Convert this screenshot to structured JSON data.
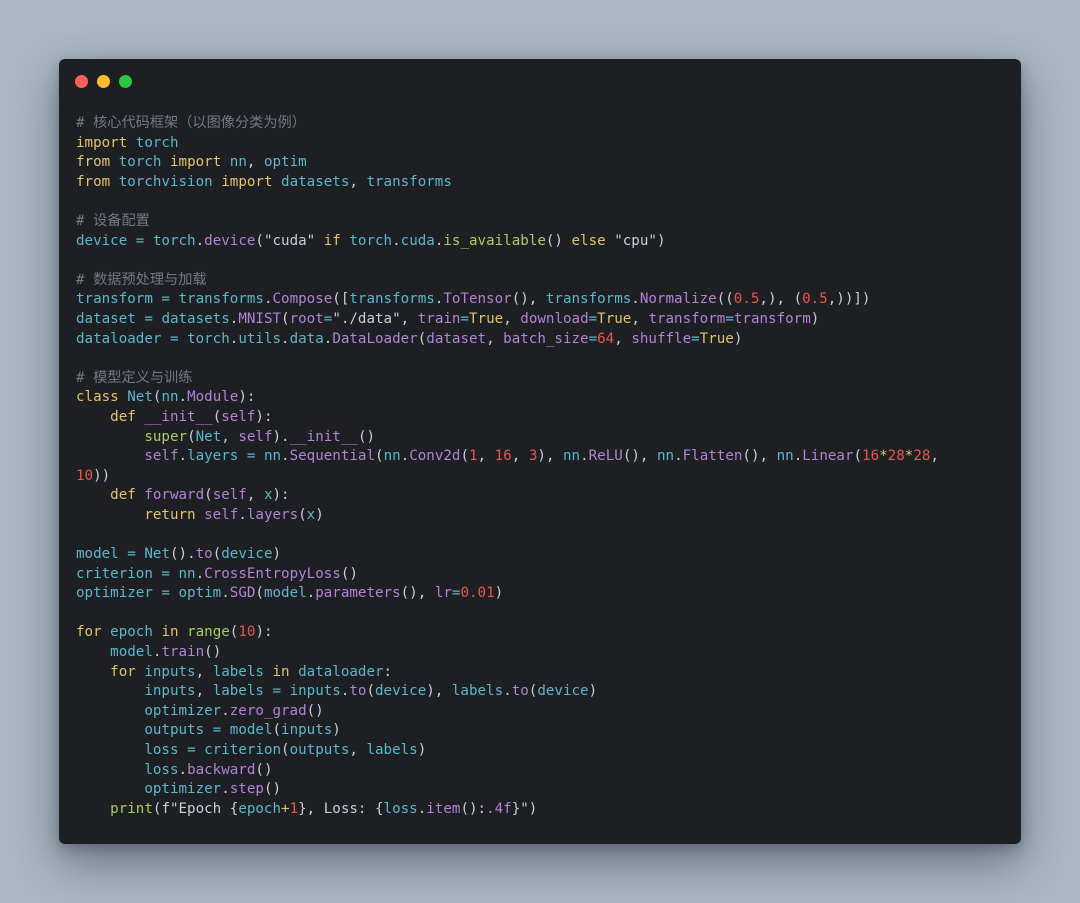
{
  "window": {
    "traffic_lights": [
      {
        "name": "close",
        "color": "#ff5f57"
      },
      {
        "name": "minimize",
        "color": "#febc2e"
      },
      {
        "name": "maximize",
        "color": "#28c840"
      }
    ]
  },
  "colors": {
    "background": "#abb6c3",
    "editor": "#1e1f22",
    "keyword": "#e3c36a",
    "function": "#b482d8",
    "identifier": "#58b8cf",
    "builtin": "#a6ce66",
    "number": "#e5584d",
    "comment": "#707a85",
    "string": "#c6cfd8"
  },
  "code_lines": [
    [
      [
        "cm",
        "# 核心代码框架（以图像分类为例）"
      ]
    ],
    [
      [
        "kw",
        "import"
      ],
      [
        "pun",
        " "
      ],
      [
        "var",
        "torch"
      ]
    ],
    [
      [
        "kw",
        "from"
      ],
      [
        "pun",
        " "
      ],
      [
        "var",
        "torch"
      ],
      [
        "pun",
        " "
      ],
      [
        "kw",
        "import"
      ],
      [
        "pun",
        " "
      ],
      [
        "var",
        "nn"
      ],
      [
        "pun",
        ", "
      ],
      [
        "var",
        "optim"
      ]
    ],
    [
      [
        "kw",
        "from"
      ],
      [
        "pun",
        " "
      ],
      [
        "var",
        "torchvision"
      ],
      [
        "pun",
        " "
      ],
      [
        "kw",
        "import"
      ],
      [
        "pun",
        " "
      ],
      [
        "var",
        "datasets"
      ],
      [
        "pun",
        ", "
      ],
      [
        "var",
        "transforms"
      ]
    ],
    [],
    [
      [
        "cm",
        "# 设备配置"
      ]
    ],
    [
      [
        "var",
        "device"
      ],
      [
        "pun",
        " "
      ],
      [
        "op",
        "="
      ],
      [
        "pun",
        " "
      ],
      [
        "var",
        "torch"
      ],
      [
        "pun",
        "."
      ],
      [
        "fn",
        "device"
      ],
      [
        "pun",
        "("
      ],
      [
        "str",
        "\"cuda\""
      ],
      [
        "pun",
        " "
      ],
      [
        "kw",
        "if"
      ],
      [
        "pun",
        " "
      ],
      [
        "var",
        "torch"
      ],
      [
        "pun",
        "."
      ],
      [
        "var",
        "cuda"
      ],
      [
        "pun",
        "."
      ],
      [
        "bi",
        "is_available"
      ],
      [
        "pun",
        "() "
      ],
      [
        "kw",
        "else"
      ],
      [
        "pun",
        " "
      ],
      [
        "str",
        "\"cpu\""
      ],
      [
        "pun",
        ")"
      ]
    ],
    [],
    [
      [
        "cm",
        "# 数据预处理与加载"
      ]
    ],
    [
      [
        "var",
        "transform"
      ],
      [
        "pun",
        " "
      ],
      [
        "op",
        "="
      ],
      [
        "pun",
        " "
      ],
      [
        "var",
        "transforms"
      ],
      [
        "pun",
        "."
      ],
      [
        "fn",
        "Compose"
      ],
      [
        "pun",
        "(["
      ],
      [
        "var",
        "transforms"
      ],
      [
        "pun",
        "."
      ],
      [
        "fn",
        "ToTensor"
      ],
      [
        "pun",
        "(), "
      ],
      [
        "var",
        "transforms"
      ],
      [
        "pun",
        "."
      ],
      [
        "fn",
        "Normalize"
      ],
      [
        "pun",
        "(("
      ],
      [
        "num",
        "0.5"
      ],
      [
        "pun",
        ",), ("
      ],
      [
        "num",
        "0.5"
      ],
      [
        "pun",
        ",))])"
      ]
    ],
    [
      [
        "var",
        "dataset"
      ],
      [
        "pun",
        " "
      ],
      [
        "op",
        "="
      ],
      [
        "pun",
        " "
      ],
      [
        "var",
        "datasets"
      ],
      [
        "pun",
        "."
      ],
      [
        "fn",
        "MNIST"
      ],
      [
        "pun",
        "("
      ],
      [
        "fn",
        "root"
      ],
      [
        "op",
        "="
      ],
      [
        "str",
        "\"./data\""
      ],
      [
        "pun",
        ", "
      ],
      [
        "fn",
        "train"
      ],
      [
        "op",
        "="
      ],
      [
        "kw",
        "True"
      ],
      [
        "pun",
        ", "
      ],
      [
        "fn",
        "download"
      ],
      [
        "op",
        "="
      ],
      [
        "kw",
        "True"
      ],
      [
        "pun",
        ", "
      ],
      [
        "fn",
        "transform"
      ],
      [
        "op",
        "="
      ],
      [
        "fn",
        "transform"
      ],
      [
        "pun",
        ")"
      ]
    ],
    [
      [
        "var",
        "dataloader"
      ],
      [
        "pun",
        " "
      ],
      [
        "op",
        "="
      ],
      [
        "pun",
        " "
      ],
      [
        "var",
        "torch"
      ],
      [
        "pun",
        "."
      ],
      [
        "var",
        "utils"
      ],
      [
        "pun",
        "."
      ],
      [
        "var",
        "data"
      ],
      [
        "pun",
        "."
      ],
      [
        "fn",
        "DataLoader"
      ],
      [
        "pun",
        "("
      ],
      [
        "fn",
        "dataset"
      ],
      [
        "pun",
        ", "
      ],
      [
        "fn",
        "batch_size"
      ],
      [
        "op",
        "="
      ],
      [
        "num",
        "64"
      ],
      [
        "pun",
        ", "
      ],
      [
        "fn",
        "shuffle"
      ],
      [
        "op",
        "="
      ],
      [
        "kw",
        "True"
      ],
      [
        "pun",
        ")"
      ]
    ],
    [],
    [
      [
        "cm",
        "# 模型定义与训练"
      ]
    ],
    [
      [
        "kw",
        "class"
      ],
      [
        "pun",
        " "
      ],
      [
        "cls",
        "Net"
      ],
      [
        "pun",
        "("
      ],
      [
        "var",
        "nn"
      ],
      [
        "pun",
        "."
      ],
      [
        "fn",
        "Module"
      ],
      [
        "pun",
        "):"
      ]
    ],
    [
      [
        "pun",
        "    "
      ],
      [
        "kw",
        "def"
      ],
      [
        "pun",
        " "
      ],
      [
        "fn",
        "__init__"
      ],
      [
        "pun",
        "("
      ],
      [
        "self",
        "self"
      ],
      [
        "pun",
        "):"
      ]
    ],
    [
      [
        "pun",
        "        "
      ],
      [
        "bi",
        "super"
      ],
      [
        "pun",
        "("
      ],
      [
        "cls",
        "Net"
      ],
      [
        "pun",
        ", "
      ],
      [
        "self",
        "self"
      ],
      [
        "pun",
        ")."
      ],
      [
        "fn",
        "__init__"
      ],
      [
        "pun",
        "()"
      ]
    ],
    [
      [
        "pun",
        "        "
      ],
      [
        "self",
        "self"
      ],
      [
        "pun",
        "."
      ],
      [
        "var",
        "layers"
      ],
      [
        "pun",
        " "
      ],
      [
        "op",
        "="
      ],
      [
        "pun",
        " "
      ],
      [
        "var",
        "nn"
      ],
      [
        "pun",
        "."
      ],
      [
        "fn",
        "Sequential"
      ],
      [
        "pun",
        "("
      ],
      [
        "var",
        "nn"
      ],
      [
        "pun",
        "."
      ],
      [
        "fn",
        "Conv2d"
      ],
      [
        "pun",
        "("
      ],
      [
        "num",
        "1"
      ],
      [
        "pun",
        ", "
      ],
      [
        "num",
        "16"
      ],
      [
        "pun",
        ", "
      ],
      [
        "num",
        "3"
      ],
      [
        "pun",
        "), "
      ],
      [
        "var",
        "nn"
      ],
      [
        "pun",
        "."
      ],
      [
        "fn",
        "ReLU"
      ],
      [
        "pun",
        "(), "
      ],
      [
        "var",
        "nn"
      ],
      [
        "pun",
        "."
      ],
      [
        "fn",
        "Flatten"
      ],
      [
        "pun",
        "(), "
      ],
      [
        "var",
        "nn"
      ],
      [
        "pun",
        "."
      ],
      [
        "fn",
        "Linear"
      ],
      [
        "pun",
        "("
      ],
      [
        "num",
        "16"
      ],
      [
        "kw",
        "*"
      ],
      [
        "num",
        "28"
      ],
      [
        "kw",
        "*"
      ],
      [
        "num",
        "28"
      ],
      [
        "pun",
        ","
      ]
    ],
    [
      [
        "num",
        "10"
      ],
      [
        "pun",
        "))"
      ]
    ],
    [
      [
        "pun",
        "    "
      ],
      [
        "kw",
        "def"
      ],
      [
        "pun",
        " "
      ],
      [
        "fn",
        "forward"
      ],
      [
        "pun",
        "("
      ],
      [
        "self",
        "self"
      ],
      [
        "pun",
        ", "
      ],
      [
        "var",
        "x"
      ],
      [
        "pun",
        "):"
      ]
    ],
    [
      [
        "pun",
        "        "
      ],
      [
        "kw",
        "return"
      ],
      [
        "pun",
        " "
      ],
      [
        "self",
        "self"
      ],
      [
        "pun",
        "."
      ],
      [
        "fn",
        "layers"
      ],
      [
        "pun",
        "("
      ],
      [
        "var",
        "x"
      ],
      [
        "pun",
        ")"
      ]
    ],
    [],
    [
      [
        "var",
        "model"
      ],
      [
        "pun",
        " "
      ],
      [
        "op",
        "="
      ],
      [
        "pun",
        " "
      ],
      [
        "cls",
        "Net"
      ],
      [
        "pun",
        "()."
      ],
      [
        "fn",
        "to"
      ],
      [
        "pun",
        "("
      ],
      [
        "var",
        "device"
      ],
      [
        "pun",
        ")"
      ]
    ],
    [
      [
        "var",
        "criterion"
      ],
      [
        "pun",
        " "
      ],
      [
        "op",
        "="
      ],
      [
        "pun",
        " "
      ],
      [
        "var",
        "nn"
      ],
      [
        "pun",
        "."
      ],
      [
        "fn",
        "CrossEntropyLoss"
      ],
      [
        "pun",
        "()"
      ]
    ],
    [
      [
        "var",
        "optimizer"
      ],
      [
        "pun",
        " "
      ],
      [
        "op",
        "="
      ],
      [
        "pun",
        " "
      ],
      [
        "var",
        "optim"
      ],
      [
        "pun",
        "."
      ],
      [
        "fn",
        "SGD"
      ],
      [
        "pun",
        "("
      ],
      [
        "var",
        "model"
      ],
      [
        "pun",
        "."
      ],
      [
        "fn",
        "parameters"
      ],
      [
        "pun",
        "(), "
      ],
      [
        "fn",
        "lr"
      ],
      [
        "op",
        "="
      ],
      [
        "num",
        "0.01"
      ],
      [
        "pun",
        ")"
      ]
    ],
    [],
    [
      [
        "kw",
        "for"
      ],
      [
        "pun",
        " "
      ],
      [
        "var",
        "epoch"
      ],
      [
        "pun",
        " "
      ],
      [
        "kw",
        "in"
      ],
      [
        "pun",
        " "
      ],
      [
        "bi",
        "range"
      ],
      [
        "pun",
        "("
      ],
      [
        "num",
        "10"
      ],
      [
        "pun",
        "):"
      ]
    ],
    [
      [
        "pun",
        "    "
      ],
      [
        "var",
        "model"
      ],
      [
        "pun",
        "."
      ],
      [
        "fn",
        "train"
      ],
      [
        "pun",
        "()"
      ]
    ],
    [
      [
        "pun",
        "    "
      ],
      [
        "kw",
        "for"
      ],
      [
        "pun",
        " "
      ],
      [
        "var",
        "inputs"
      ],
      [
        "pun",
        ", "
      ],
      [
        "var",
        "labels"
      ],
      [
        "pun",
        " "
      ],
      [
        "kw",
        "in"
      ],
      [
        "pun",
        " "
      ],
      [
        "var",
        "dataloader"
      ],
      [
        "pun",
        ":"
      ]
    ],
    [
      [
        "pun",
        "        "
      ],
      [
        "var",
        "inputs"
      ],
      [
        "pun",
        ", "
      ],
      [
        "var",
        "labels"
      ],
      [
        "pun",
        " "
      ],
      [
        "op",
        "="
      ],
      [
        "pun",
        " "
      ],
      [
        "var",
        "inputs"
      ],
      [
        "pun",
        "."
      ],
      [
        "fn",
        "to"
      ],
      [
        "pun",
        "("
      ],
      [
        "var",
        "device"
      ],
      [
        "pun",
        "), "
      ],
      [
        "var",
        "labels"
      ],
      [
        "pun",
        "."
      ],
      [
        "fn",
        "to"
      ],
      [
        "pun",
        "("
      ],
      [
        "var",
        "device"
      ],
      [
        "pun",
        ")"
      ]
    ],
    [
      [
        "pun",
        "        "
      ],
      [
        "var",
        "optimizer"
      ],
      [
        "pun",
        "."
      ],
      [
        "fn",
        "zero_grad"
      ],
      [
        "pun",
        "()"
      ]
    ],
    [
      [
        "pun",
        "        "
      ],
      [
        "var",
        "outputs"
      ],
      [
        "pun",
        " "
      ],
      [
        "op",
        "="
      ],
      [
        "pun",
        " "
      ],
      [
        "var",
        "model"
      ],
      [
        "pun",
        "("
      ],
      [
        "var",
        "inputs"
      ],
      [
        "pun",
        ")"
      ]
    ],
    [
      [
        "pun",
        "        "
      ],
      [
        "var",
        "loss"
      ],
      [
        "pun",
        " "
      ],
      [
        "op",
        "="
      ],
      [
        "pun",
        " "
      ],
      [
        "var",
        "criterion"
      ],
      [
        "pun",
        "("
      ],
      [
        "var",
        "outputs"
      ],
      [
        "pun",
        ", "
      ],
      [
        "var",
        "labels"
      ],
      [
        "pun",
        ")"
      ]
    ],
    [
      [
        "pun",
        "        "
      ],
      [
        "var",
        "loss"
      ],
      [
        "pun",
        "."
      ],
      [
        "fn",
        "backward"
      ],
      [
        "pun",
        "()"
      ]
    ],
    [
      [
        "pun",
        "        "
      ],
      [
        "var",
        "optimizer"
      ],
      [
        "pun",
        "."
      ],
      [
        "fn",
        "step"
      ],
      [
        "pun",
        "()"
      ]
    ],
    [
      [
        "pun",
        "    "
      ],
      [
        "bi",
        "print"
      ],
      [
        "pun",
        "("
      ],
      [
        "str",
        "f\"Epoch {"
      ],
      [
        "var",
        "epoch"
      ],
      [
        "kw",
        "+"
      ],
      [
        "num",
        "1"
      ],
      [
        "str",
        "}, Loss: {"
      ],
      [
        "var",
        "loss"
      ],
      [
        "pun",
        "."
      ],
      [
        "fn",
        "item"
      ],
      [
        "pun",
        "():"
      ],
      [
        "fn",
        ".4f"
      ],
      [
        "str",
        "}\""
      ],
      [
        "pun",
        ")"
      ]
    ]
  ]
}
